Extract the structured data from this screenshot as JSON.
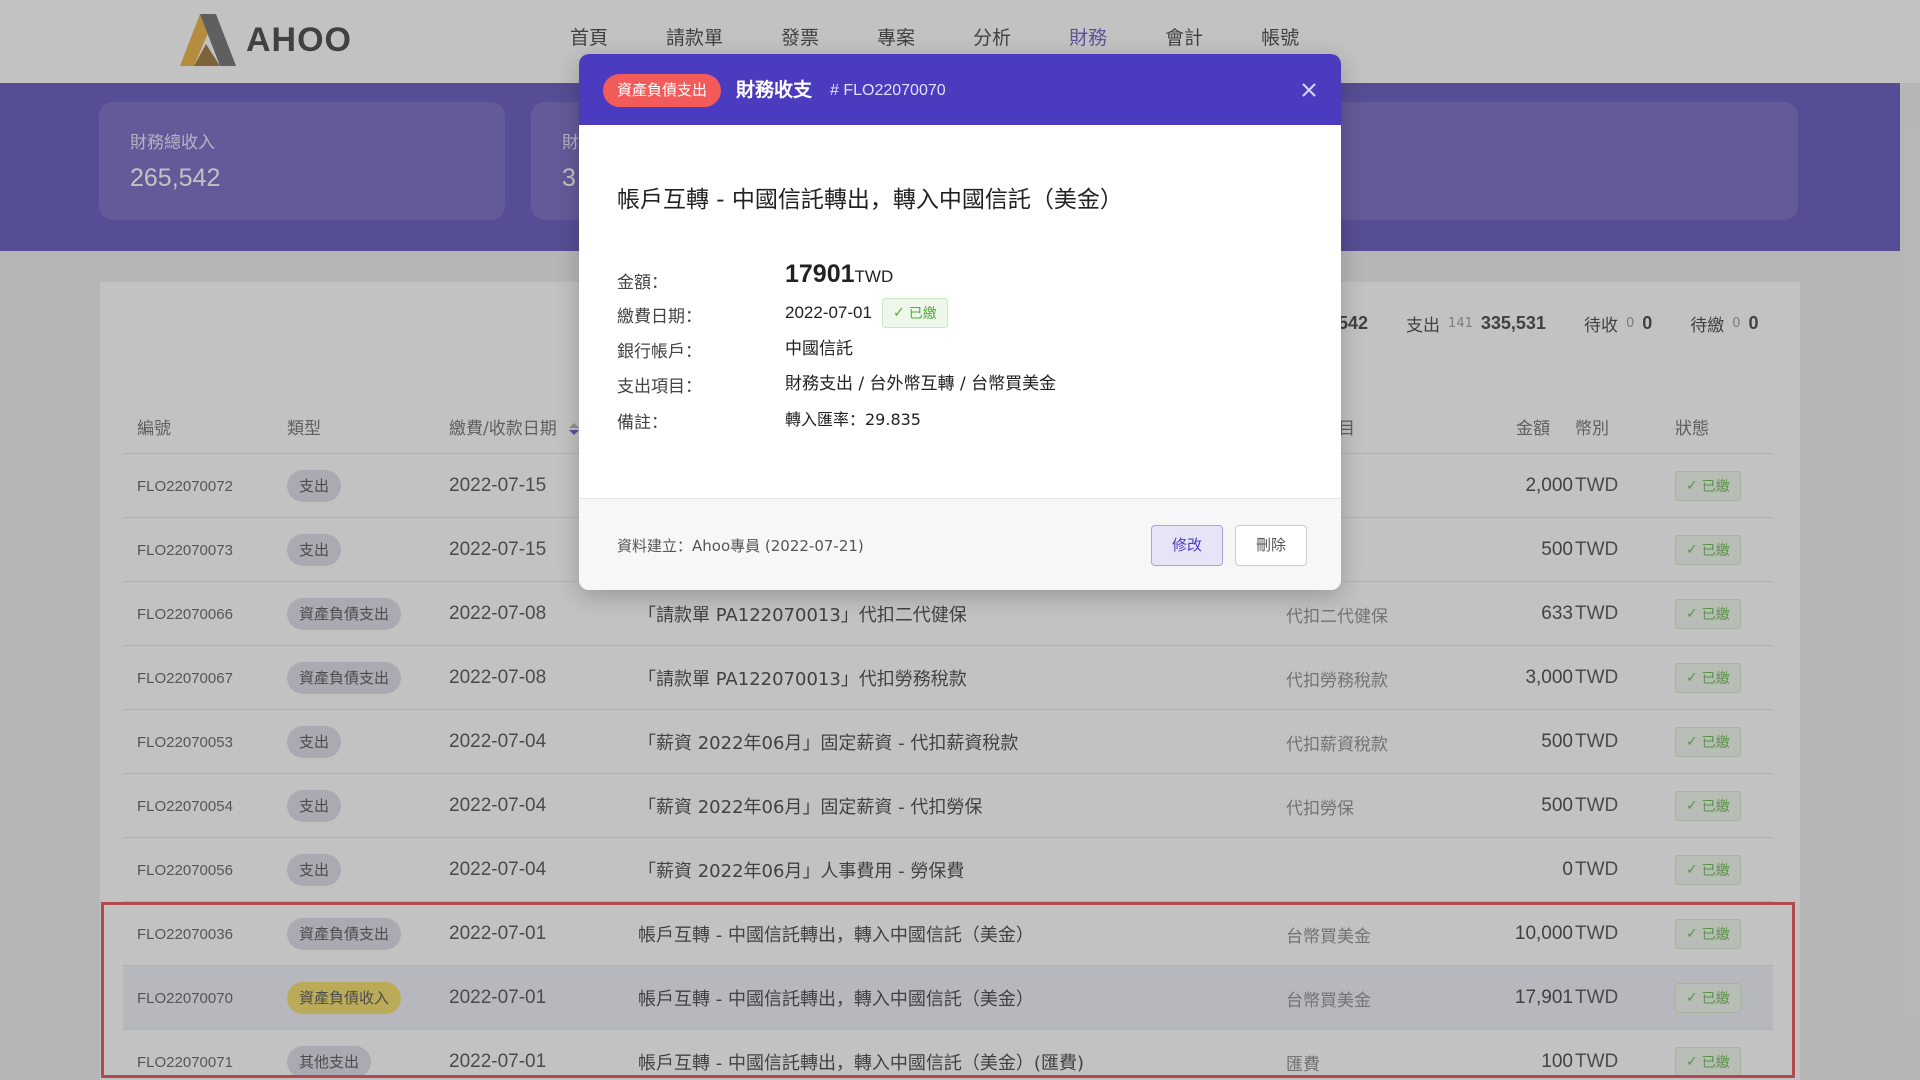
{
  "app": {
    "logo_text": "AHOO"
  },
  "nav": [
    {
      "label": "首頁"
    },
    {
      "label": "請款單"
    },
    {
      "label": "發票"
    },
    {
      "label": "專案"
    },
    {
      "label": "分析"
    },
    {
      "label": "財務",
      "active": true
    },
    {
      "label": "會計"
    },
    {
      "label": "帳號"
    }
  ],
  "stats": {
    "income_label": "財務總收入",
    "income_value": "265,542",
    "second_label_partial": "財",
    "second_value_partial": "3"
  },
  "summary": {
    "income_partial": "5,542",
    "expense_label": "支出",
    "expense_count": "141",
    "expense_amount": "335,531",
    "to_receive_label": "待收",
    "to_receive_count": "0",
    "to_receive_amount": "0",
    "to_pay_label": "待繳",
    "to_pay_count": "0",
    "to_pay_amount": "0"
  },
  "table": {
    "headers": {
      "id": "編號",
      "type": "類型",
      "date": "繳費/收款日期",
      "item_partial": "目",
      "amount": "金額",
      "currency": "幣別",
      "status": "狀態"
    },
    "rows": [
      {
        "id": "FLO22070072",
        "type": "支出",
        "date": "2022-07-15",
        "desc": "",
        "item": "",
        "amount": "2,000",
        "currency": "TWD",
        "status": "已繳"
      },
      {
        "id": "FLO22070073",
        "type": "支出",
        "date": "2022-07-15",
        "desc": "",
        "item": "",
        "amount": "500",
        "currency": "TWD",
        "status": "已繳"
      },
      {
        "id": "FLO22070066",
        "type": "資產負債支出",
        "date": "2022-07-08",
        "desc": "「請款單 PA122070013」代扣二代健保",
        "item": "代扣二代健保",
        "amount": "633",
        "currency": "TWD",
        "status": "已繳"
      },
      {
        "id": "FLO22070067",
        "type": "資產負債支出",
        "date": "2022-07-08",
        "desc": "「請款單 PA122070013」代扣勞務稅款",
        "item": "代扣勞務稅款",
        "amount": "3,000",
        "currency": "TWD",
        "status": "已繳"
      },
      {
        "id": "FLO22070053",
        "type": "支出",
        "date": "2022-07-04",
        "desc": "「薪資 2022年06月」固定薪資 - 代扣薪資稅款",
        "item": "代扣薪資稅款",
        "amount": "500",
        "currency": "TWD",
        "status": "已繳"
      },
      {
        "id": "FLO22070054",
        "type": "支出",
        "date": "2022-07-04",
        "desc": "「薪資 2022年06月」固定薪資 - 代扣勞保",
        "item": "代扣勞保",
        "amount": "500",
        "currency": "TWD",
        "status": "已繳"
      },
      {
        "id": "FLO22070056",
        "type": "支出",
        "date": "2022-07-04",
        "desc": "「薪資 2022年06月」人事費用 - 勞保費",
        "item": "",
        "amount": "0",
        "currency": "TWD",
        "status": "已繳"
      },
      {
        "id": "FLO22070036",
        "type": "資產負債支出",
        "date": "2022-07-01",
        "desc": "帳戶互轉 - 中國信託轉出，轉入中國信託（美金）",
        "item": "台幣買美金",
        "amount": "10,000",
        "currency": "TWD",
        "status": "已繳"
      },
      {
        "id": "FLO22070070",
        "type": "資產負債收入",
        "date": "2022-07-01",
        "desc": "帳戶互轉 - 中國信託轉出，轉入中國信託（美金）",
        "item": "台幣買美金",
        "amount": "17,901",
        "currency": "TWD",
        "status": "已繳"
      },
      {
        "id": "FLO22070071",
        "type": "其他支出",
        "date": "2022-07-01",
        "desc": "帳戶互轉 - 中國信託轉出，轉入中國信託（美金）(匯費)",
        "item": "匯費",
        "amount": "100",
        "currency": "TWD",
        "status": "已繳"
      }
    ]
  },
  "modal": {
    "badge": "資產負債支出",
    "title": "財務收支",
    "number": "# FLO22070070",
    "heading": "帳戶互轉 - 中國信託轉出，轉入中國信託（美金）",
    "amount_label": "金額：",
    "amount_value": "17901",
    "amount_unit": "TWD",
    "date_label": "繳費日期：",
    "date_value": "2022-07-01",
    "date_status": "已繳",
    "bank_label": "銀行帳戶：",
    "bank_value": "中國信託",
    "item_label": "支出項目：",
    "item_value": "財務支出 / 台外幣互轉 / 台幣買美金",
    "note_label": "備註：",
    "note_value": "轉入匯率：29.835",
    "created": "資料建立：Ahoo專員 (2022-07-21)",
    "edit_label": "修改",
    "delete_label": "刪除"
  },
  "colors": {
    "brand": "#4637b0",
    "modal_header": "#4b3bbf",
    "badge": "#f35b5b",
    "highlight_box": "#e32f3a",
    "paid_green": "#55aa3c"
  }
}
